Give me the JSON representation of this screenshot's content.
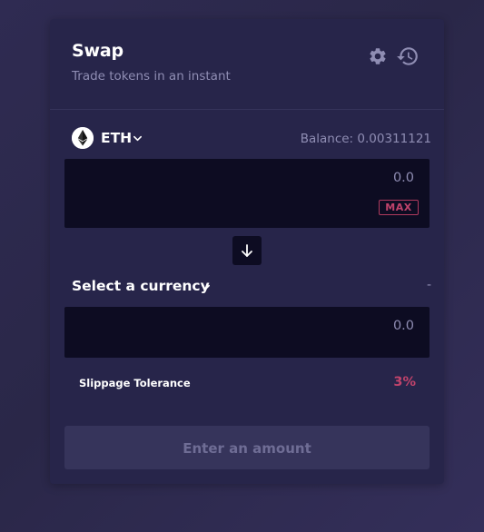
{
  "header": {
    "title": "Swap",
    "subtitle": "Trade tokens in an instant",
    "settings_icon": "gear-icon",
    "history_icon": "history-icon"
  },
  "from": {
    "token_symbol": "ETH",
    "token_icon": "eth-logo-icon",
    "balance_text": "Balance: 0.00311121",
    "amount_placeholder": "0.0",
    "max_label": "MAX"
  },
  "switch": {
    "icon": "arrow-down-icon"
  },
  "to": {
    "select_label": "Select a currency",
    "balance_text": "-",
    "amount_placeholder": "0.0"
  },
  "slippage": {
    "label": "Slippage Tolerance",
    "value": "3%"
  },
  "submit": {
    "label": "Enter an amount",
    "enabled": false
  },
  "colors": {
    "background": "#2c2950",
    "card": "#27254a",
    "input_bg": "#0d0c22",
    "muted_text": "#8f8db3",
    "accent": "#c0436b",
    "button_disabled": "#36345b"
  }
}
